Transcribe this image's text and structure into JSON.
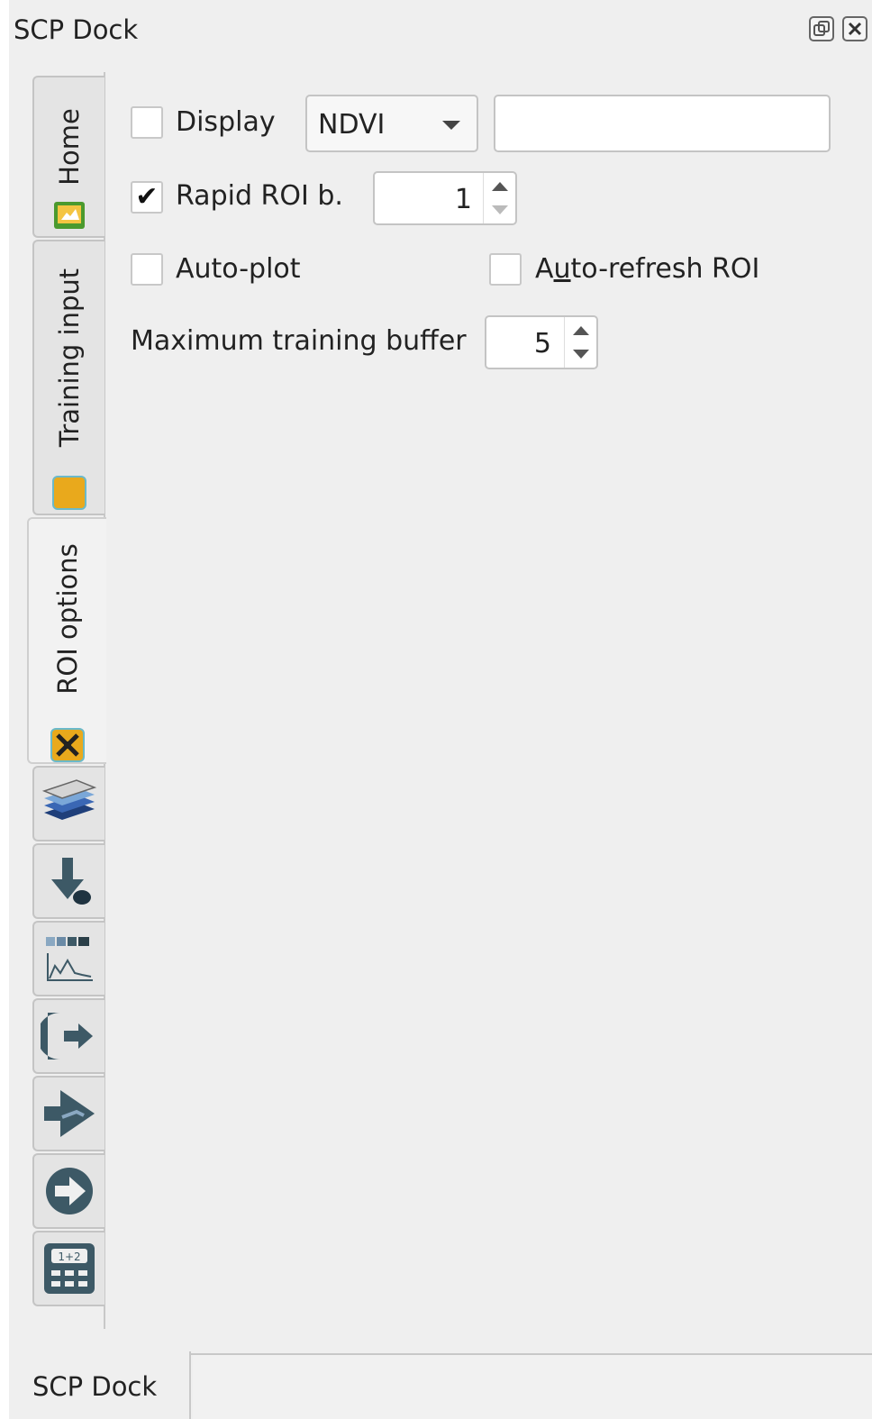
{
  "window": {
    "title": "SCP Dock",
    "float_icon": "float-icon",
    "close_icon": "close-icon"
  },
  "tabs": [
    {
      "label": "Home",
      "icon": "home-icon",
      "active": false
    },
    {
      "label": "Training input",
      "icon": "training-input-icon",
      "active": false
    },
    {
      "label": "ROI options",
      "icon": "roi-options-icon",
      "active": true
    }
  ],
  "icon_tabs": [
    {
      "icon": "band-set-icon"
    },
    {
      "icon": "download-icon"
    },
    {
      "icon": "histogram-icon"
    },
    {
      "icon": "preprocessing-icon"
    },
    {
      "icon": "processing-icon"
    },
    {
      "icon": "postprocessing-icon"
    },
    {
      "icon": "band-calc-icon"
    }
  ],
  "roi_options": {
    "display": {
      "label": "Display",
      "checked": false
    },
    "display_combo": {
      "value": "NDVI"
    },
    "display_field": {
      "value": ""
    },
    "rapid_roi": {
      "label": "Rapid ROI b.",
      "checked": true,
      "value": "1"
    },
    "auto_plot": {
      "label": "Auto-plot",
      "checked": false
    },
    "auto_refresh": {
      "label_pre": "A",
      "label_underline": "u",
      "label_post": "to-refresh ROI",
      "checked": false
    },
    "max_buffer": {
      "label": "Maximum training buffer",
      "value": "5"
    }
  },
  "bottom": {
    "tab_label": "SCP Dock"
  }
}
